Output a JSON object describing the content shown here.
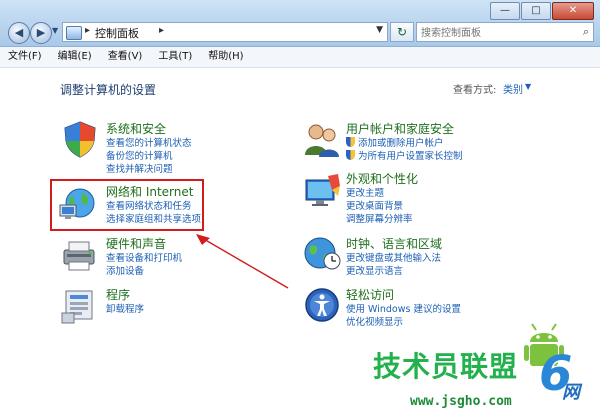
{
  "window": {
    "controls": {
      "minimize": "—",
      "maximize": "□",
      "close": "✕"
    }
  },
  "nav": {
    "back": "◀",
    "forward": "▶",
    "address": {
      "path": "控制面板",
      "separator": "▸",
      "after_arrow": "▸"
    },
    "refresh": "↻",
    "search": {
      "placeholder": "搜索控制面板"
    }
  },
  "menubar": {
    "items": [
      {
        "label": "文件(F)"
      },
      {
        "label": "编辑(E)"
      },
      {
        "label": "查看(V)"
      },
      {
        "label": "工具(T)"
      },
      {
        "label": "帮助(H)"
      }
    ]
  },
  "content": {
    "heading": "调整计算机的设置",
    "view_by": {
      "label": "查看方式:",
      "value": "类别",
      "icon": "chevron-down-icon"
    }
  },
  "categories_left": [
    {
      "icon": "system-security-icon",
      "title": "系统和安全",
      "links": [
        "查看您的计算机状态",
        "备份您的计算机",
        "查找并解决问题"
      ]
    },
    {
      "icon": "network-internet-icon",
      "title": "网络和 Internet",
      "links": [
        "查看网络状态和任务",
        "选择家庭组和共享选项"
      ]
    },
    {
      "icon": "hardware-sound-icon",
      "title": "硬件和声音",
      "links": [
        "查看设备和打印机",
        "添加设备"
      ]
    },
    {
      "icon": "programs-icon",
      "title": "程序",
      "links": [
        "卸载程序"
      ]
    }
  ],
  "categories_right": [
    {
      "icon": "user-accounts-icon",
      "title": "用户帐户和家庭安全",
      "links": [
        "添加或删除用户帐户",
        "为所有用户设置家长控制"
      ]
    },
    {
      "icon": "appearance-icon",
      "title": "外观和个性化",
      "links": [
        "更改主题",
        "更改桌面背景",
        "调整屏幕分辨率"
      ]
    },
    {
      "icon": "clock-region-icon",
      "title": "时钟、语言和区域",
      "links": [
        "更改键盘或其他输入法",
        "更改显示语言"
      ]
    },
    {
      "icon": "ease-of-access-icon",
      "title": "轻松访问",
      "links": [
        "使用 Windows 建议的设置",
        "优化视频显示"
      ]
    }
  ],
  "watermark": {
    "text": "技术员联盟",
    "url": "www.jsgho.com",
    "brand_mark": "6",
    "brand_suffix": "网"
  },
  "colors": {
    "category_title": "#1f6f1d",
    "link": "#1c5fb4",
    "highlight": "#d21b1b"
  }
}
